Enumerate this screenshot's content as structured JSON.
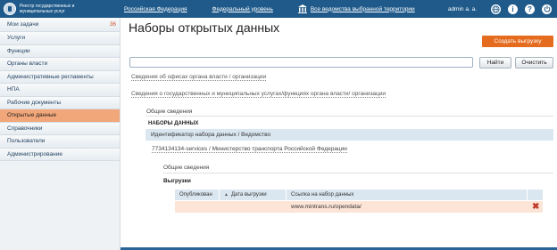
{
  "header": {
    "brand_line1": "Реестр государственных и",
    "brand_line2": "муниципальных услуг",
    "nav": [
      "Российская Федерация",
      "Федеральный уровень",
      "Все ведомства выбранной территории"
    ],
    "user": "admin a. a.",
    "icons": [
      "globe-icon",
      "info-icon",
      "help-icon",
      "power-icon"
    ]
  },
  "sidebar": {
    "items": [
      {
        "label": "Мои задачи",
        "count": "36"
      },
      {
        "label": "Услуги"
      },
      {
        "label": "Функции"
      },
      {
        "label": "Органы власти"
      },
      {
        "label": "Административные регламенты"
      },
      {
        "label": "НПА"
      },
      {
        "label": "Рабочие документы"
      },
      {
        "label": "Открытые данные",
        "active": true
      },
      {
        "label": "Справочники"
      },
      {
        "label": "Пользователи"
      },
      {
        "label": "Администрирование"
      }
    ]
  },
  "main": {
    "title": "Наборы открытых данных",
    "create_button": "Создать выгрузку",
    "search_placeholder": "",
    "find_button": "Найти",
    "clear_button": "Очистить",
    "link_offices": "Сведения об офисах органа власти / организации",
    "link_services": "Сведения о государственных и муниципальных услугах/функциях органа власти/ организации",
    "general_info": "Общие сведения",
    "datasets_heading": "НАБОРЫ ДАННЫХ",
    "id_header": "Идентификатор набора данных /   Ведомство",
    "dataset_row": "7734134134-services / Министерство транспорта Российской Федерации",
    "general_info2": "Общие сведения",
    "uploads_heading": "Выгрузки",
    "table": {
      "columns": [
        "Опубликован",
        "Дата выгрузки",
        "Ссылка на набор данных",
        ""
      ],
      "rows": [
        {
          "published": "",
          "date": "",
          "link": "www.mintrans.ru/opendata/"
        }
      ]
    }
  },
  "colors": {
    "header_bg": "#1f5a8a",
    "accent": "#e56b1f",
    "active_item": "#f2a77a",
    "row_highlight": "#fce4d6"
  }
}
